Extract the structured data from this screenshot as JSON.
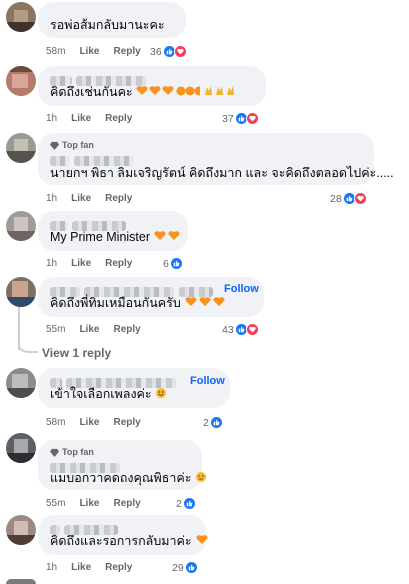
{
  "actions": {
    "like": "Like",
    "reply": "Reply"
  },
  "comments": [
    {
      "text": "รอพ่อส้มกลับมานะคะ",
      "time": "58m",
      "count": "36",
      "reacts": [
        "like",
        "love"
      ]
    },
    {
      "text": "คิดถึงเช่นกันคะ",
      "time": "1h",
      "count": "37",
      "reacts": [
        "like",
        "love"
      ]
    },
    {
      "badge": "Top fan",
      "text": "นายกฯ พิธา ลิมเจริญรัตน์ คิดถึงมาก และ จะคิดถึงตลอดไปค่ะ.....",
      "time": "1h",
      "count": "28",
      "reacts": [
        "like",
        "love"
      ]
    },
    {
      "text": "My Prime Minister",
      "time": "1h",
      "count": "6",
      "reacts": [
        "like"
      ]
    },
    {
      "follow": "Follow",
      "text": "คิดถึงพี่ทิมเหมือนกันครับ",
      "time": "55m",
      "count": "43",
      "reacts": [
        "like",
        "love"
      ]
    },
    {
      "follow": "Follow",
      "text": "เข้าใจเลือกเพลงค่ะ",
      "time": "58m",
      "count": "2",
      "reacts": [
        "like"
      ]
    },
    {
      "badge": "Top fan",
      "text": "แมบอกวาคดถงคุณพิธาค่ะ",
      "time": "55m",
      "count": "2",
      "reacts": [
        "like"
      ]
    },
    {
      "text": "คิดถึงและรอการกลับมาค่ะ",
      "time": "1h",
      "count": "29",
      "reacts": [
        "like"
      ]
    }
  ],
  "view_replies": "View 1 reply",
  "colors": {
    "like": "#1877f2",
    "love": "#f33e58",
    "link": "#0866ff",
    "bubble": "#f0f2f5",
    "meta": "#65676b"
  }
}
